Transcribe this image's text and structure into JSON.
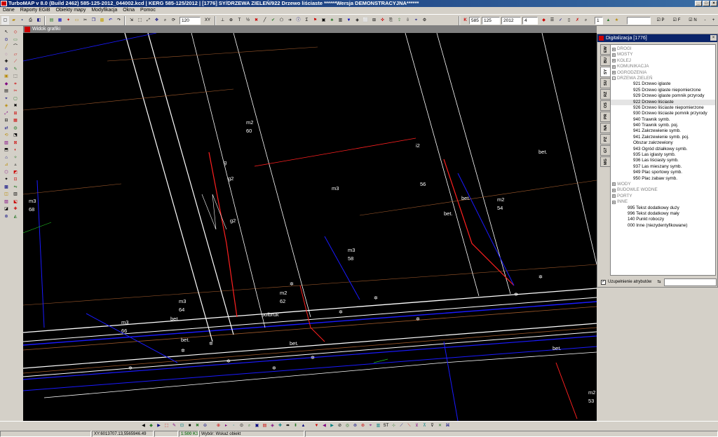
{
  "window": {
    "title": "TurboMAP v 8.0 (Build 2462)  585-125-2012_044002.kcd | KERG 585-125/2012 | [1776] SY/DRZEWA ZIELEŃ/922 Drzewo liściaste ******Wersja DEMONSTRACYJNA******"
  },
  "menu": [
    "Dane",
    "Raporty EGiB",
    "Obiekty mapy",
    "Modyfikacja",
    "Okna",
    "Pomoc"
  ],
  "toolbar": {
    "scale_value": "120",
    "scale_unit_label": "XY",
    "kerg_label": "K",
    "kerg_values": [
      "585",
      "125",
      "2012",
      "4"
    ],
    "sel_value": "1",
    "checks": [
      "P",
      "F",
      "N"
    ],
    "zoom_values": [
      "-",
      "+"
    ]
  },
  "map_window": {
    "title": "Widok grafiki"
  },
  "map_labels": [
    {
      "t": "m2",
      "c": "#ffffff"
    },
    {
      "t": "60",
      "c": "#ffffff"
    },
    {
      "t": "g2",
      "c": "#ffffff"
    },
    {
      "t": "g2",
      "c": "#ffffff"
    },
    {
      "t": "g",
      "c": "#ffffff"
    },
    {
      "t": "m3",
      "c": "#ffffff"
    },
    {
      "t": "56",
      "c": "#ffffff"
    },
    {
      "t": "m2",
      "c": "#ffffff"
    },
    {
      "t": "54",
      "c": "#ffffff"
    },
    {
      "t": "bet.",
      "c": "#ffffff"
    },
    {
      "t": "bet.",
      "c": "#ffffff"
    },
    {
      "t": "m3",
      "c": "#ffffff"
    },
    {
      "t": "58",
      "c": "#ffffff"
    },
    {
      "t": "m2",
      "c": "#ffffff"
    },
    {
      "t": "62",
      "c": "#ffffff"
    },
    {
      "t": "polbruk",
      "c": "#ffffff"
    },
    {
      "t": "m3",
      "c": "#ffffff"
    },
    {
      "t": "64",
      "c": "#ffffff"
    },
    {
      "t": "bet.",
      "c": "#ffffff"
    },
    {
      "t": "m3",
      "c": "#ffffff"
    },
    {
      "t": "66",
      "c": "#ffffff"
    },
    {
      "t": "m3",
      "c": "#ffffff"
    },
    {
      "t": "68",
      "c": "#ffffff"
    },
    {
      "t": "m2",
      "c": "#ffffff"
    },
    {
      "t": "53",
      "c": "#ffffff"
    },
    {
      "t": "bet.",
      "c": "#ffffff"
    },
    {
      "t": "bet.",
      "c": "#ffffff"
    },
    {
      "t": "bet.",
      "c": "#ffffff"
    },
    {
      "t": "i2",
      "c": "#ffffff"
    },
    {
      "t": "bet.",
      "c": "#ffffff"
    }
  ],
  "digitalizacja": {
    "title": "Digitalizacja [1776]",
    "tabs": [
      "EW",
      "BU",
      "SY",
      "SU",
      "RZ",
      "OS",
      "PR",
      "NA",
      "PZ",
      "G7",
      "MG"
    ],
    "tree": [
      {
        "kind": "group",
        "label": "DROGI",
        "sign": "+"
      },
      {
        "kind": "group",
        "label": "MOSTY",
        "sign": "+"
      },
      {
        "kind": "group",
        "label": "KOLEJ",
        "sign": "+"
      },
      {
        "kind": "group",
        "label": "KOMUNIKACJA",
        "sign": "+"
      },
      {
        "kind": "group",
        "label": "OGRODZENIA",
        "sign": "+"
      },
      {
        "kind": "group",
        "label": "DRZEWA ZIELEŃ",
        "sign": "−"
      },
      {
        "kind": "child",
        "label": "921 Drzewo iglaste"
      },
      {
        "kind": "child",
        "label": "925 Drzewo iglaste niepomierzone"
      },
      {
        "kind": "child",
        "label": "929 Drzewo iglaste pomnik przyrody"
      },
      {
        "kind": "child sel",
        "label": "922 Drzewo liściaste"
      },
      {
        "kind": "child",
        "label": "926 Drzewo liściaste niepomierzone"
      },
      {
        "kind": "child",
        "label": "930 Drzewo liściaste pomnik przyrody"
      },
      {
        "kind": "child",
        "label": "940 Trawnik symb."
      },
      {
        "kind": "child",
        "label": "940 Trawnik symb. poj."
      },
      {
        "kind": "child",
        "label": "941 Zakrzewienie symb."
      },
      {
        "kind": "child",
        "label": "941 Zakrzewienie symb. poj."
      },
      {
        "kind": "child",
        "label": "Obszar zakrzewiony"
      },
      {
        "kind": "child",
        "label": "943 Ogród działkowy symb."
      },
      {
        "kind": "child",
        "label": "935 Las iglasty symb."
      },
      {
        "kind": "child",
        "label": "936 Las liściasty symb."
      },
      {
        "kind": "child",
        "label": "937 Las mieszany symb."
      },
      {
        "kind": "child",
        "label": "949 Plac sportowy symb."
      },
      {
        "kind": "child",
        "label": "950 Plac zabaw symb."
      },
      {
        "kind": "group",
        "label": "WODY",
        "sign": "+"
      },
      {
        "kind": "group",
        "label": "BUDOWLE WODNE",
        "sign": "+"
      },
      {
        "kind": "group",
        "label": "PORTY",
        "sign": "+"
      },
      {
        "kind": "group",
        "label": "INNE",
        "sign": "+"
      },
      {
        "kind": "free",
        "label": "995 Tekst dodatkowy duży"
      },
      {
        "kind": "free",
        "label": "996 Tekst dodatkowy mały"
      },
      {
        "kind": "free",
        "label": "140 Punkt roboczy"
      },
      {
        "kind": "free",
        "label": "000 Inne (niezydentyfikowane)"
      }
    ],
    "checkbox_label": "Uzupełnienie atrybutów",
    "checkbox_checked": true
  },
  "status": {
    "coords": "XY:6013707.13,5565946.49",
    "scale": "1:500",
    "scale_extra": "K1",
    "mode_hint": "Wybór: Wskaż obiekt"
  },
  "colors": {
    "title_start": "#0a246a",
    "title_end": "#3a6ea5",
    "map_bg": "#000000",
    "line_white": "#ffffff",
    "line_blue": "#1a1aff",
    "line_red": "#ff2020",
    "line_brown": "#a05a2c"
  }
}
